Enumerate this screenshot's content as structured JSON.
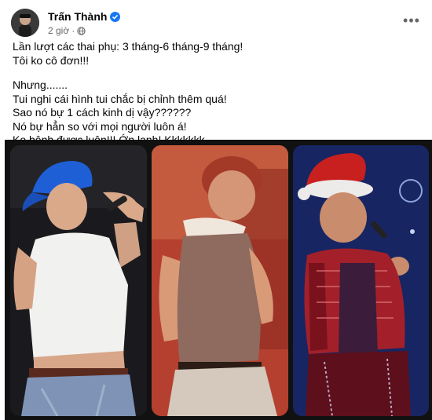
{
  "post": {
    "author": "Trấn Thành",
    "time": "2 giờ",
    "more_label": "•••",
    "lines": [
      "Lần lượt các thai phụ: 3 tháng-6 tháng-9 tháng!",
      "Tôi ko cô đơn!!!",
      "Nhưng.......",
      "Tui nghi cái hình tui chắc bị chỉnh thêm quá!",
      "Sao nó bự 1 cách kinh dị vậy??????",
      "Nó bự hẳn so với mọi người luôn á!",
      "Ko bênh được luôn!!! Ớn lạnh! Kkkkkkk"
    ]
  },
  "icons": {
    "verified": "verified-badge-icon",
    "privacy": "globe-icon",
    "menu": "more-options-icon"
  },
  "colors": {
    "verified": "#1877f2",
    "meta_text": "#65676b",
    "strip_bg": "#111111"
  },
  "photos": [
    {
      "name": "photo-singer-blue-cap"
    },
    {
      "name": "photo-singer-red-tank"
    },
    {
      "name": "photo-singer-santa-hat"
    }
  ]
}
